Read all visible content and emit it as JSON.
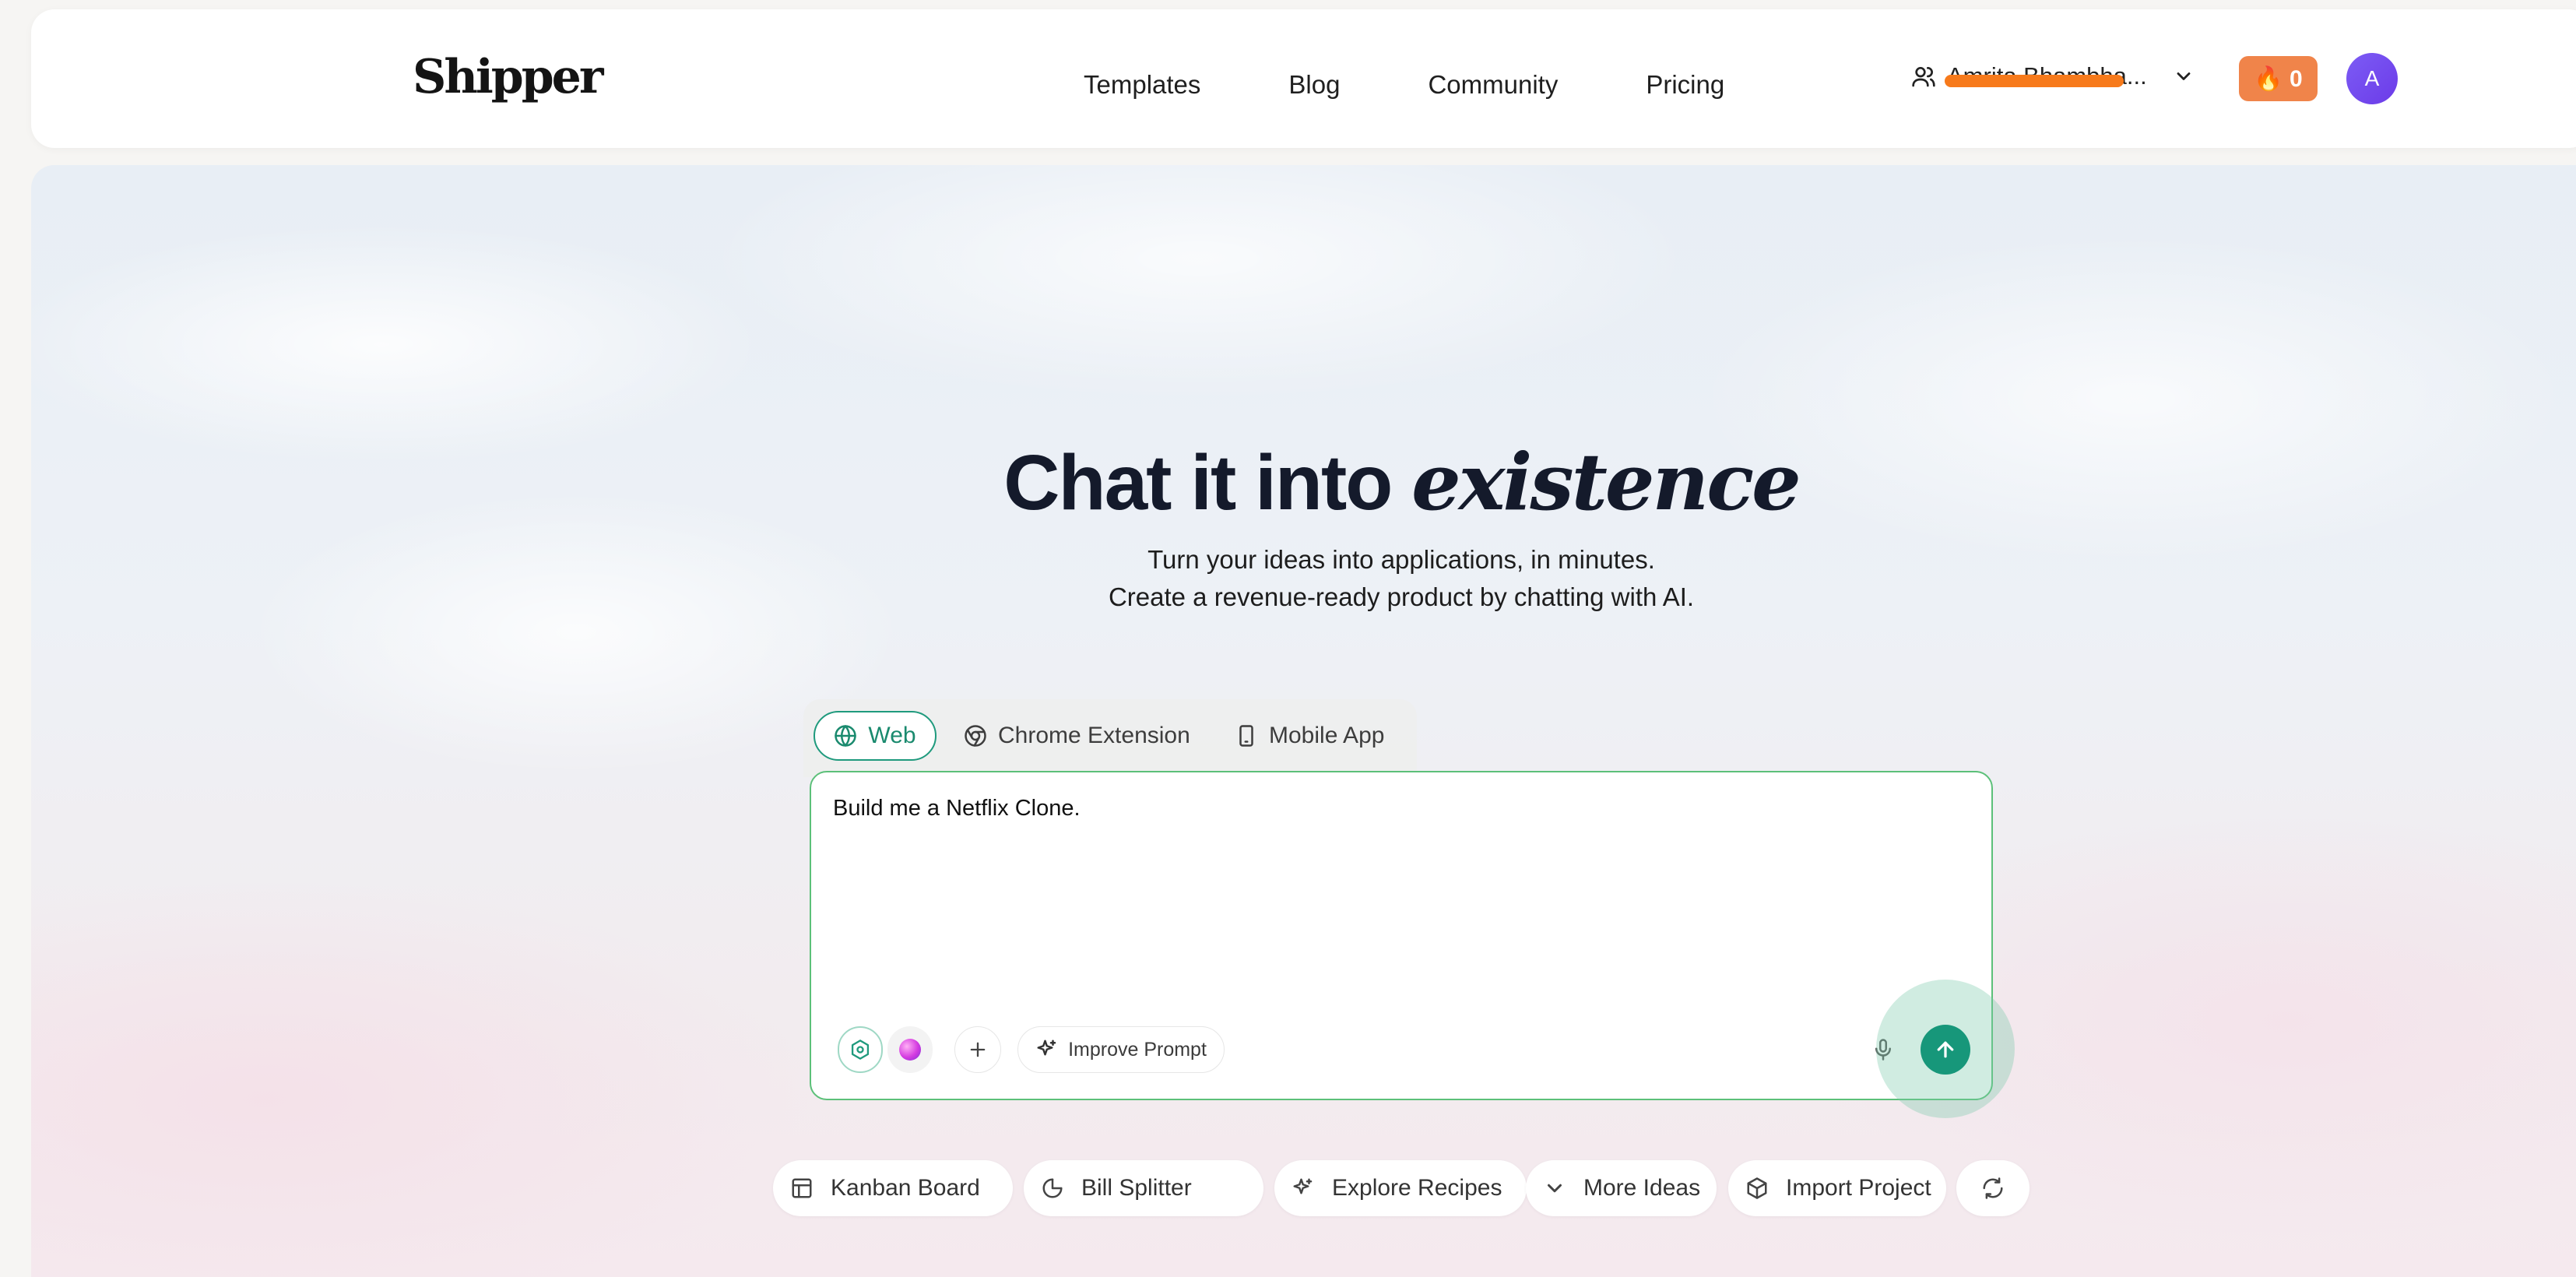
{
  "header": {
    "logo": "Shipper",
    "nav": [
      "Templates",
      "Blog",
      "Community",
      "Pricing"
    ],
    "user_name": "Amrita Bhambha...",
    "streak_label": "🔥 0",
    "avatar_initial": "A"
  },
  "hero": {
    "headline_plain": "Chat it into ",
    "headline_emphasis": "existence",
    "subtitle_line1": "Turn your ideas into applications, in minutes.",
    "subtitle_line2": "Create a revenue-ready product by chatting with AI."
  },
  "composer": {
    "tabs": [
      {
        "label": "Web",
        "icon": "globe-icon",
        "active": true
      },
      {
        "label": "Chrome Extension",
        "icon": "chrome-icon",
        "active": false
      },
      {
        "label": "Mobile App",
        "icon": "phone-icon",
        "active": false
      }
    ],
    "prompt_value": "Build me a Netflix Clone.",
    "improve_label": "Improve Prompt"
  },
  "suggestions": [
    {
      "label": "Kanban Board",
      "icon": "grid-icon"
    },
    {
      "label": "Bill Splitter",
      "icon": "pie-icon"
    },
    {
      "label": "Explore Recipes",
      "icon": "sparkle-icon"
    },
    {
      "label": "More Ideas",
      "icon": "chevron-down-icon"
    },
    {
      "label": "Import Project",
      "icon": "box-icon"
    }
  ],
  "colors": {
    "accent": "#17977a",
    "composer_border": "#5cc079",
    "streak": "#f0844a",
    "avatar": "#7c5cf5",
    "redaction": "#f77a1b"
  }
}
